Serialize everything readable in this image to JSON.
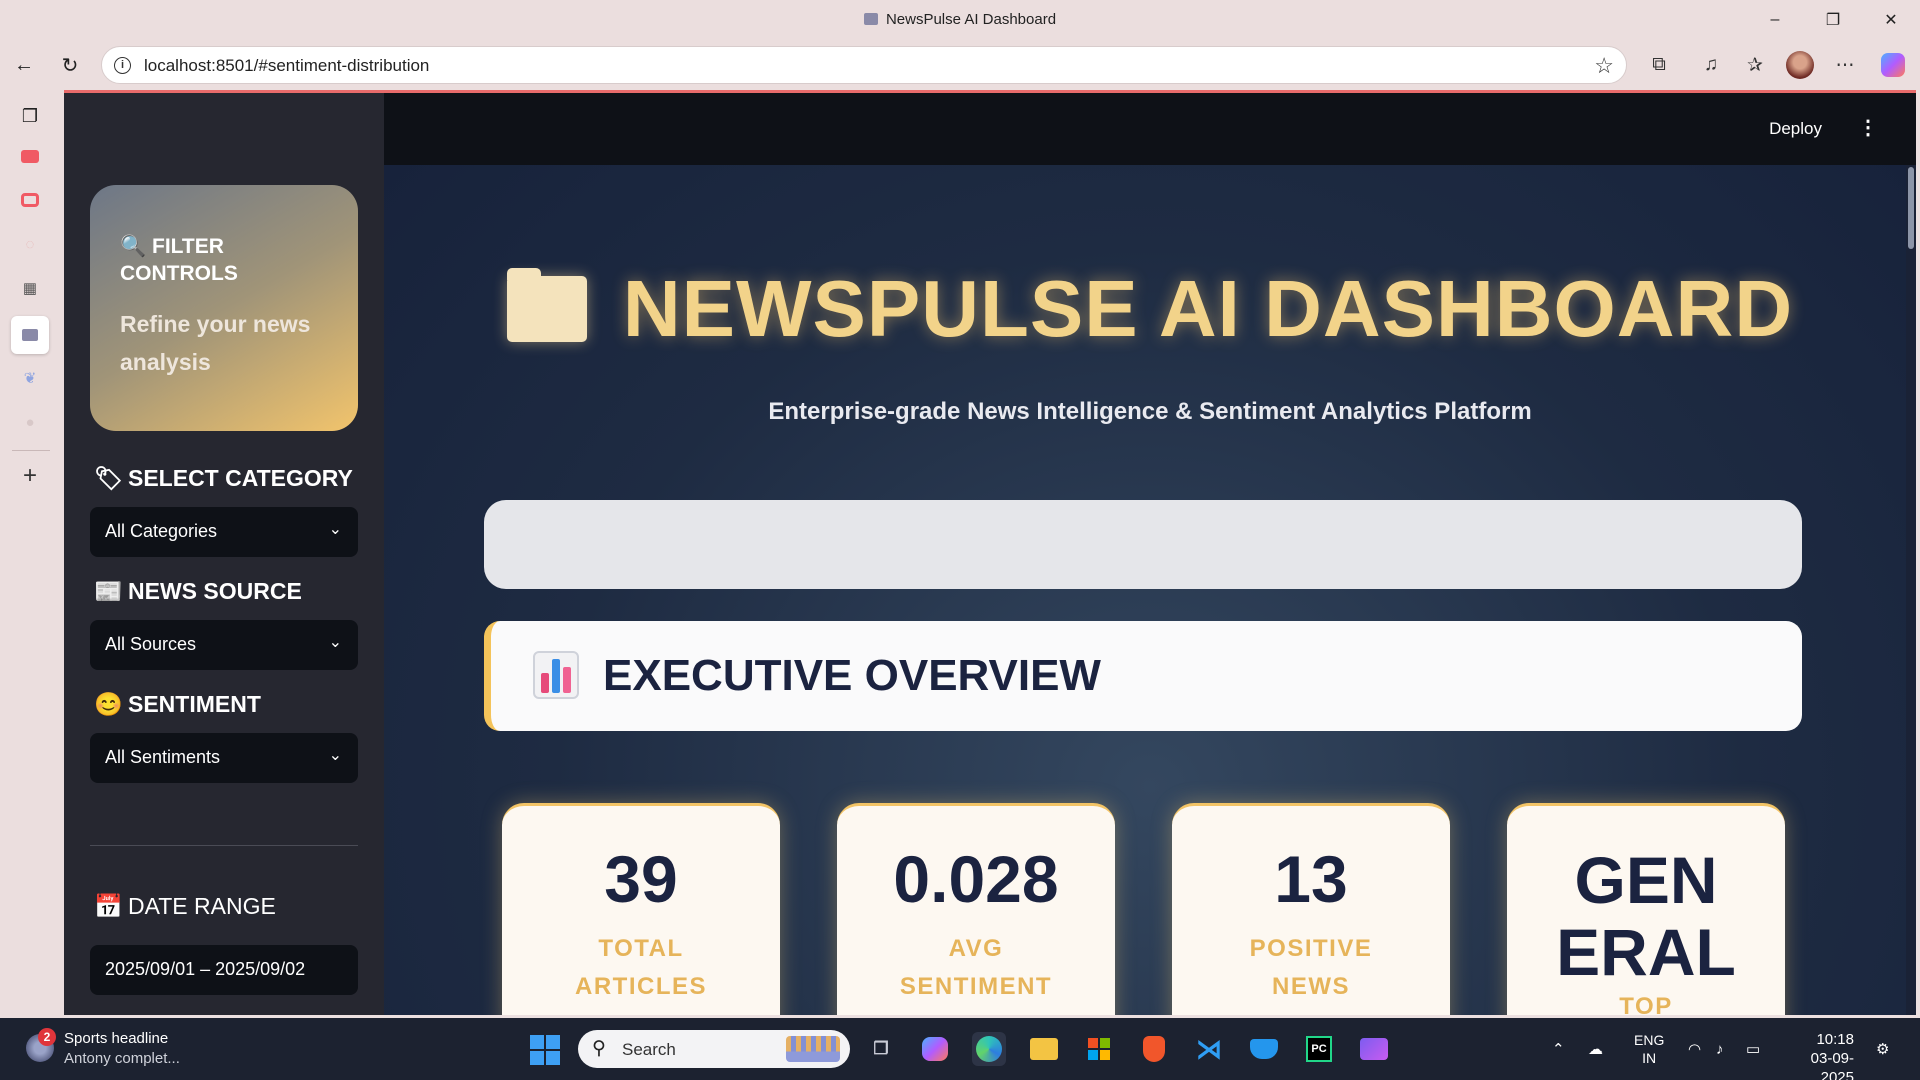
{
  "browser": {
    "window_title": "NewsPulse AI Dashboard",
    "url": "localhost:8501/#sentiment-distribution",
    "minimize": "–",
    "restore": "❐",
    "close": "✕"
  },
  "app": {
    "deploy_label": "Deploy",
    "menu_label": "⋮"
  },
  "sidebar": {
    "filter_title_icon": "🔍",
    "filter_title": "FILTER CONTROLS",
    "filter_subtitle": "Refine your news analysis",
    "category": {
      "icon": "🏷",
      "label": "SELECT CATEGORY",
      "value": "All Categories"
    },
    "source": {
      "icon": "📰",
      "label": "NEWS SOURCE",
      "value": "All Sources"
    },
    "sentiment": {
      "icon": "😊",
      "label": "SENTIMENT",
      "value": "All Sentiments"
    },
    "date": {
      "icon": "📅",
      "label": "DATE RANGE",
      "value": "2025/09/01 – 2025/09/02"
    }
  },
  "main": {
    "title": "NEWSPULSE AI DASHBOARD",
    "subtitle": "Enterprise-grade News Intelligence & Sentiment Analytics Platform",
    "section_title": "EXECUTIVE OVERVIEW",
    "kpis": [
      {
        "value": "39",
        "label_line1": "TOTAL",
        "label_line2": "ARTICLES"
      },
      {
        "value": "0.028",
        "label_line1": "AVG",
        "label_line2": "SENTIMENT"
      },
      {
        "value": "13",
        "label_line1": "POSITIVE",
        "label_line2": "NEWS"
      },
      {
        "value_line1": "GEN",
        "value_line2": "ERAL",
        "label_line1": "TOP"
      }
    ]
  },
  "taskbar": {
    "news_badge": "2",
    "news_headline": "Sports headline",
    "news_sub": "Antony complet...",
    "search_placeholder": "Search",
    "lang_line1": "ENG",
    "lang_line2": "IN",
    "time": "10:18",
    "date": "03-09-2025"
  },
  "colors": {
    "accent_gold": "#f2d38a",
    "kpi_label": "#e6b45a",
    "dark_text": "#1b2340",
    "sidebar_bg": "#262730"
  }
}
